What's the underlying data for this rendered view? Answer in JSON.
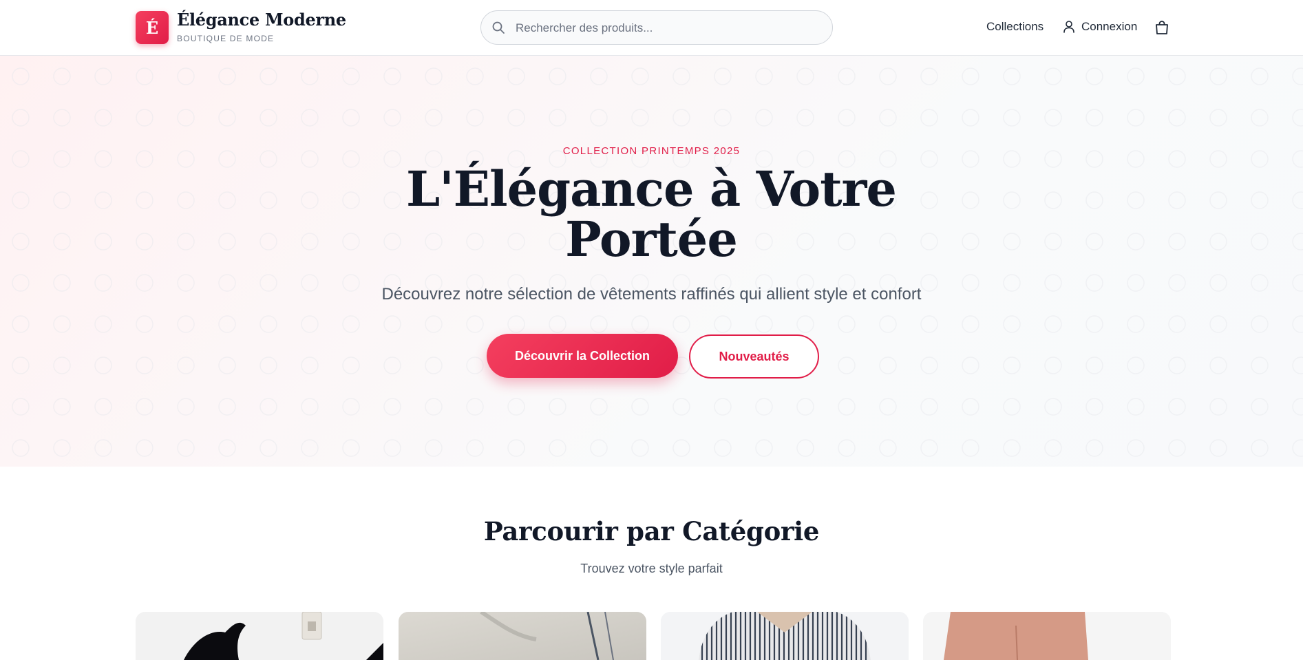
{
  "header": {
    "logo_letter": "É",
    "brand_name": "Élégance Moderne",
    "brand_tagline": "BOUTIQUE DE MODE",
    "search_placeholder": "Rechercher des produits...",
    "nav": {
      "collections": "Collections",
      "login": "Connexion"
    },
    "icons": [
      "search-icon",
      "user-icon",
      "shopping-bag-icon"
    ]
  },
  "hero": {
    "eyebrow": "COLLECTION PRINTEMPS 2025",
    "title": "L'Élégance à Votre Portée",
    "subtitle": "Découvrez notre sélection de vêtements raffinés qui allient style et confort",
    "primary_button": "Découvrir la Collection",
    "secondary_button": "Nouveautés"
  },
  "categories": {
    "title": "Parcourir par Catégorie",
    "subtitle": "Trouvez votre style parfait"
  },
  "colors": {
    "accent": "#e11d48",
    "accent_light": "#f43f5e",
    "text_dark": "#111827",
    "text_muted": "#4b5563"
  }
}
